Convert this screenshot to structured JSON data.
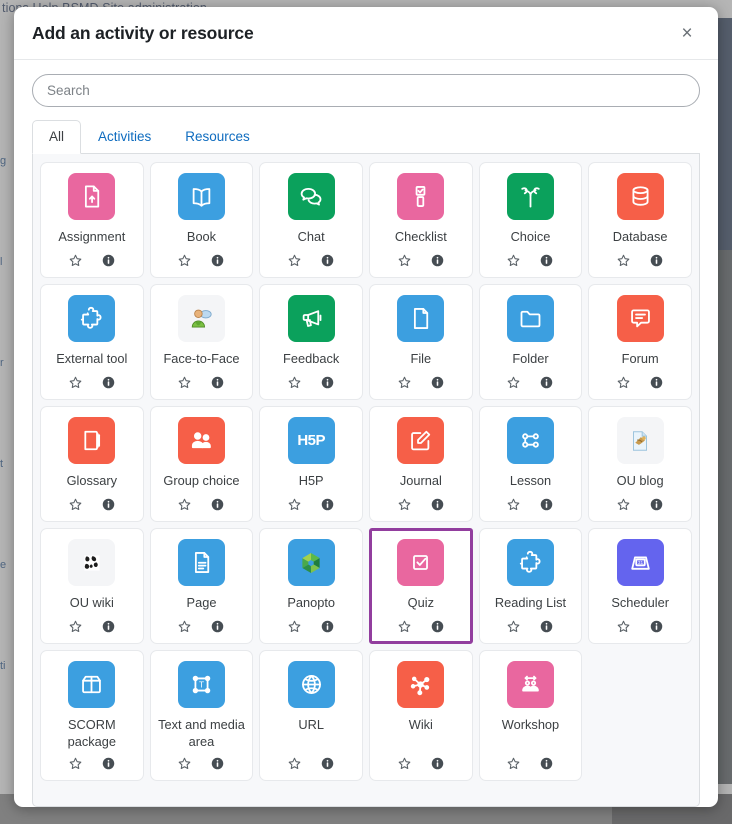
{
  "background": {
    "top_text": "tions    Help    BSMD    Site administration",
    "left_fragments": [
      "g",
      "l",
      "r",
      "t",
      "e",
      "ti"
    ]
  },
  "modal": {
    "title": "Add an activity or resource",
    "close_label": "×",
    "close_icon": "close-icon"
  },
  "search": {
    "placeholder": "Search",
    "value": ""
  },
  "tabs": [
    {
      "label": "All",
      "active": true
    },
    {
      "label": "Activities",
      "active": false
    },
    {
      "label": "Resources",
      "active": false
    }
  ],
  "card_actions": {
    "star_icon": "star-outline-icon",
    "star_title": "Star",
    "info_icon": "info-circle-icon",
    "info_title": "Help"
  },
  "focus_color": "#923e9e",
  "activities": [
    {
      "label": "Assignment",
      "icon": "assignment-icon",
      "color": "#e9679f",
      "style": "solid",
      "focused": false
    },
    {
      "label": "Book",
      "icon": "book-icon",
      "color": "#3c9fe0",
      "style": "solid",
      "focused": false
    },
    {
      "label": "Chat",
      "icon": "chat-icon",
      "color": "#0ba15c",
      "style": "solid",
      "focused": false
    },
    {
      "label": "Checklist",
      "icon": "checklist-icon",
      "color": "#e9679f",
      "style": "solid",
      "focused": false
    },
    {
      "label": "Choice",
      "icon": "choice-icon",
      "color": "#0ba15c",
      "style": "solid",
      "focused": false
    },
    {
      "label": "Database",
      "icon": "database-icon",
      "color": "#f65f48",
      "style": "solid",
      "focused": false
    },
    {
      "label": "External tool",
      "icon": "puzzle-piece-icon",
      "color": "#3c9fe0",
      "style": "solid",
      "focused": false
    },
    {
      "label": "Face-to-Face",
      "icon": "face-to-face-icon",
      "color": "#f4f5f7",
      "style": "legacy",
      "focused": false
    },
    {
      "label": "Feedback",
      "icon": "megaphone-icon",
      "color": "#0ba15c",
      "style": "solid",
      "focused": false
    },
    {
      "label": "File",
      "icon": "file-icon",
      "color": "#3c9fe0",
      "style": "solid",
      "focused": false
    },
    {
      "label": "Folder",
      "icon": "folder-icon",
      "color": "#3c9fe0",
      "style": "solid",
      "focused": false
    },
    {
      "label": "Forum",
      "icon": "forum-icon",
      "color": "#f65f48",
      "style": "solid",
      "focused": false
    },
    {
      "label": "Glossary",
      "icon": "glossary-icon",
      "color": "#f65f48",
      "style": "solid",
      "focused": false
    },
    {
      "label": "Group choice",
      "icon": "group-choice-icon",
      "color": "#f65f48",
      "style": "solid",
      "focused": false
    },
    {
      "label": "H5P",
      "icon": "h5p-logo-icon",
      "color": "#3c9fe0",
      "style": "text",
      "focused": false
    },
    {
      "label": "Journal",
      "icon": "journal-icon",
      "color": "#f65f48",
      "style": "solid",
      "focused": false
    },
    {
      "label": "Lesson",
      "icon": "lesson-icon",
      "color": "#3c9fe0",
      "style": "solid",
      "focused": false
    },
    {
      "label": "OU blog",
      "icon": "ou-blog-icon",
      "color": "#f4f5f7",
      "style": "legacy",
      "focused": false
    },
    {
      "label": "OU wiki",
      "icon": "ou-wiki-icon",
      "color": "#f4f5f7",
      "style": "legacy",
      "focused": false
    },
    {
      "label": "Page",
      "icon": "page-icon",
      "color": "#3c9fe0",
      "style": "solid",
      "focused": false
    },
    {
      "label": "Panopto",
      "icon": "panopto-logo-icon",
      "color": "#3c9fe0",
      "style": "solid",
      "focused": false
    },
    {
      "label": "Quiz",
      "icon": "quiz-icon",
      "color": "#e9679f",
      "style": "solid",
      "focused": true
    },
    {
      "label": "Reading List",
      "icon": "puzzle-piece-icon",
      "color": "#3c9fe0",
      "style": "solid",
      "focused": false
    },
    {
      "label": "Scheduler",
      "icon": "scheduler-icon",
      "color": "#6464ee",
      "style": "solid",
      "focused": false
    },
    {
      "label": "SCORM package",
      "icon": "scorm-package-icon",
      "color": "#3c9fe0",
      "style": "solid",
      "focused": false
    },
    {
      "label": "Text and media area",
      "icon": "text-media-icon",
      "color": "#3c9fe0",
      "style": "solid",
      "focused": false
    },
    {
      "label": "URL",
      "icon": "globe-icon",
      "color": "#3c9fe0",
      "style": "solid",
      "focused": false
    },
    {
      "label": "Wiki",
      "icon": "wiki-icon",
      "color": "#f65f48",
      "style": "solid",
      "focused": false
    },
    {
      "label": "Workshop",
      "icon": "workshop-icon",
      "color": "#e9679f",
      "style": "solid",
      "focused": false
    }
  ]
}
